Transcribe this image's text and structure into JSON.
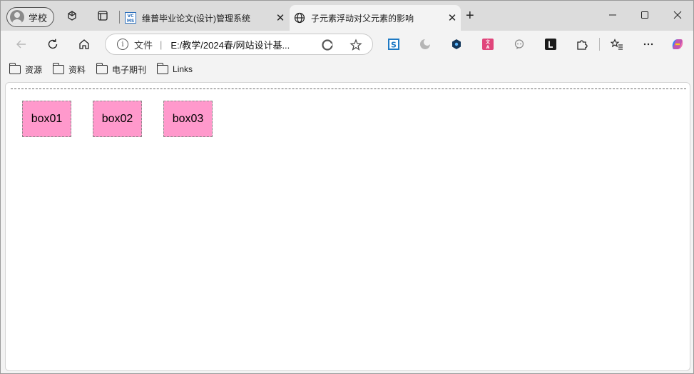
{
  "profile": {
    "label": "学校",
    "icon": "person-icon"
  },
  "tabs": [
    {
      "title": "维普毕业论文(设计)管理系统",
      "favicon": "vcms-icon",
      "active": false
    },
    {
      "title": "子元素浮动对父元素的影响",
      "favicon": "globe-icon",
      "active": true
    }
  ],
  "address_bar": {
    "protocol_label": "文件",
    "url": "E:/教学/2024春/网站设计基..."
  },
  "bookmarks": [
    "资源",
    "资料",
    "电子期刊",
    "Links"
  ],
  "page": {
    "boxes": [
      "box01",
      "box02",
      "box03"
    ],
    "box_color": "#ff99cc"
  }
}
